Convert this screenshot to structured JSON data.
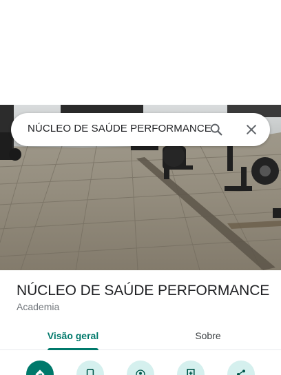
{
  "search": {
    "query": "NÚCLEO DE SAÚDE PERFORMANCE"
  },
  "place": {
    "name": "NÚCLEO DE SAÚDE PERFORMANCE",
    "category": "Academia"
  },
  "tabs": [
    {
      "label": "Visão geral",
      "selected": true
    },
    {
      "label": "Sobre",
      "selected": false
    }
  ],
  "actions": [
    {
      "icon": "directions-icon"
    },
    {
      "icon": "phone-icon"
    },
    {
      "icon": "nearby-icon"
    },
    {
      "icon": "save-icon"
    },
    {
      "icon": "share-icon"
    }
  ],
  "colors": {
    "accent": "#00796b",
    "accent_light": "#d5f0ee",
    "text_primary": "#202124",
    "text_secondary": "#70757a"
  }
}
